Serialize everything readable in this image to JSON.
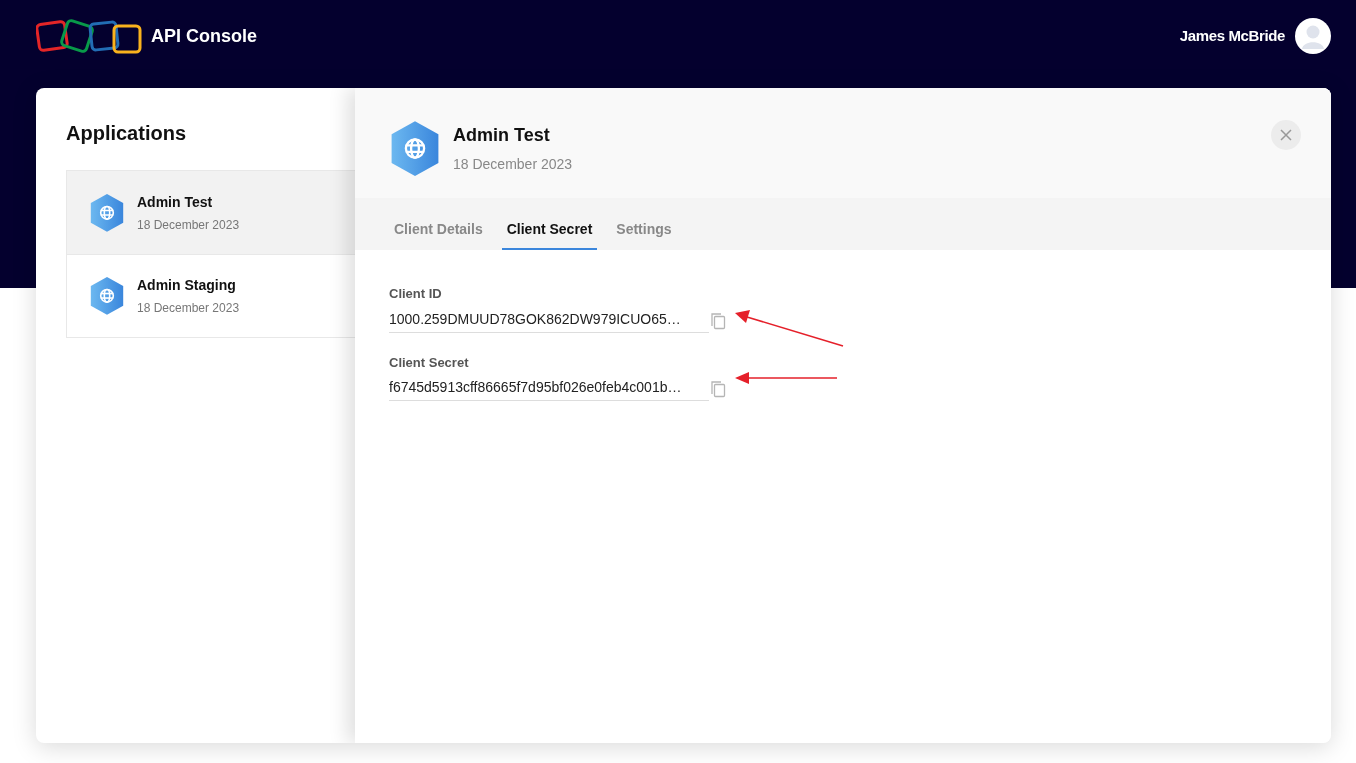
{
  "header": {
    "title": "API Console",
    "user": "James McBride"
  },
  "applications": {
    "title": "Applications",
    "items": [
      {
        "name": "Admin Test",
        "date": "18 December 2023",
        "selected": true
      },
      {
        "name": "Admin Staging",
        "date": "18 December 2023",
        "selected": false
      }
    ]
  },
  "detail": {
    "name": "Admin Test",
    "date": "18 December 2023",
    "tabs": [
      {
        "label": "Client Details",
        "selected": false
      },
      {
        "label": "Client Secret",
        "selected": true
      },
      {
        "label": "Settings",
        "selected": false
      }
    ],
    "fields": [
      {
        "label": "Client ID",
        "value": "1000.259DMUUD78GOK862DW979ICUO65…"
      },
      {
        "label": "Client Secret",
        "value": "f6745d5913cff86665f7d95bf026e0feb4c001b…"
      }
    ]
  }
}
